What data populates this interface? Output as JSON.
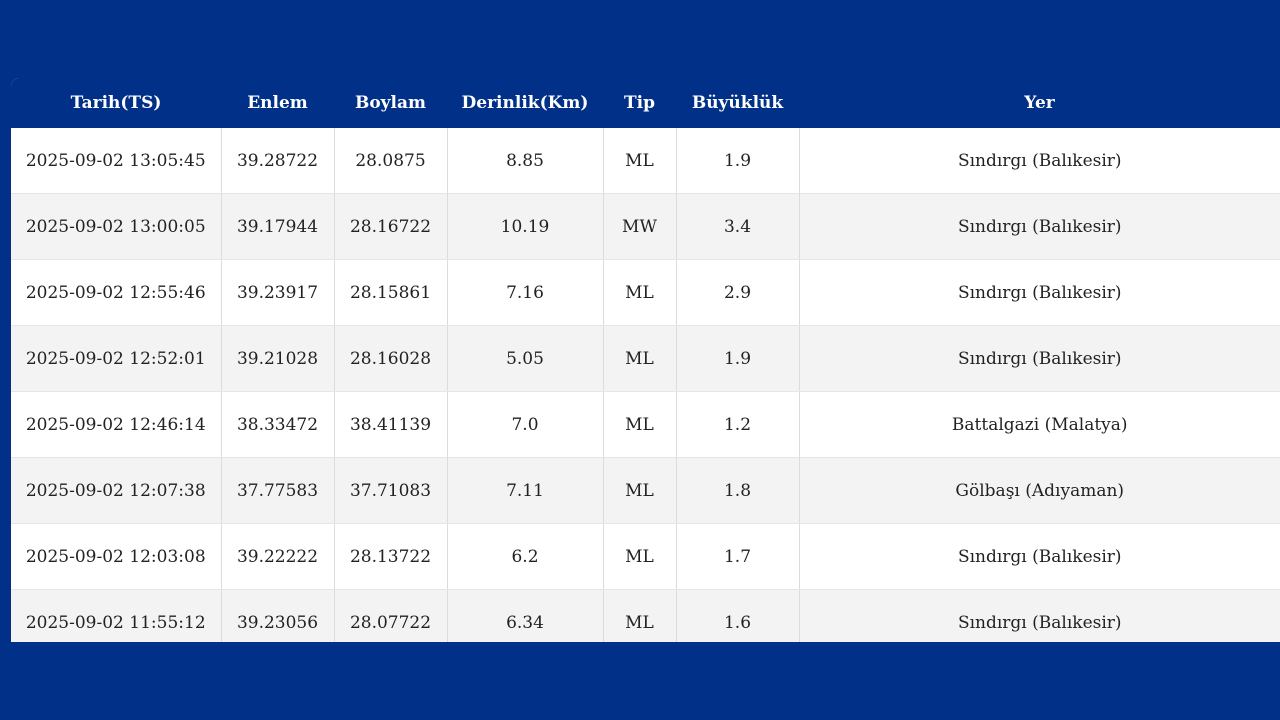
{
  "colors": {
    "brand": "#003087",
    "row_alt": "#f3f3f3",
    "row": "#ffffff",
    "text": "#222222"
  },
  "table": {
    "columns": [
      "Tarih(TS)",
      "Enlem",
      "Boylam",
      "Derinlik(Km)",
      "Tip",
      "Büyüklük",
      "Yer"
    ],
    "rows": [
      [
        "2025-09-02 13:05:45",
        "39.28722",
        "28.0875",
        "8.85",
        "ML",
        "1.9",
        "Sındırgı (Balıkesir)"
      ],
      [
        "2025-09-02 13:00:05",
        "39.17944",
        "28.16722",
        "10.19",
        "MW",
        "3.4",
        "Sındırgı (Balıkesir)"
      ],
      [
        "2025-09-02 12:55:46",
        "39.23917",
        "28.15861",
        "7.16",
        "ML",
        "2.9",
        "Sındırgı (Balıkesir)"
      ],
      [
        "2025-09-02 12:52:01",
        "39.21028",
        "28.16028",
        "5.05",
        "ML",
        "1.9",
        "Sındırgı (Balıkesir)"
      ],
      [
        "2025-09-02 12:46:14",
        "38.33472",
        "38.41139",
        "7.0",
        "ML",
        "1.2",
        "Battalgazi (Malatya)"
      ],
      [
        "2025-09-02 12:07:38",
        "37.77583",
        "37.71083",
        "7.11",
        "ML",
        "1.8",
        "Gölbaşı (Adıyaman)"
      ],
      [
        "2025-09-02 12:03:08",
        "39.22222",
        "28.13722",
        "6.2",
        "ML",
        "1.7",
        "Sındırgı (Balıkesir)"
      ],
      [
        "2025-09-02 11:55:12",
        "39.23056",
        "28.07722",
        "6.34",
        "ML",
        "1.6",
        "Sındırgı (Balıkesir)"
      ]
    ]
  }
}
